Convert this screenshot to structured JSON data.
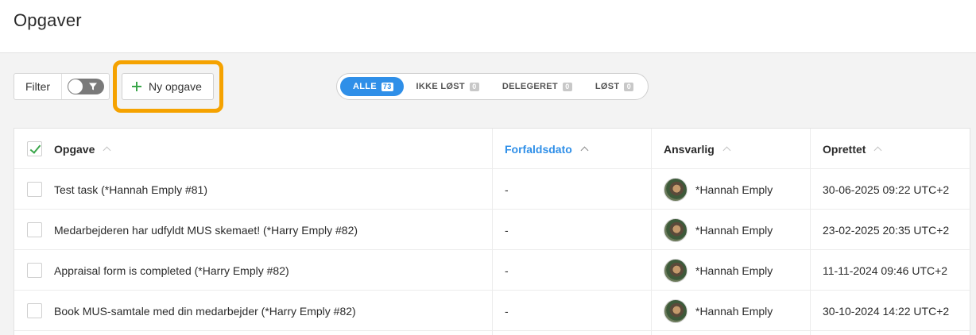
{
  "page": {
    "title": "Opgaver"
  },
  "toolbar": {
    "filter_label": "Filter",
    "new_task_label": "Ny opgave",
    "highlight_color": "#f5a200"
  },
  "status_tabs": [
    {
      "label": "ALLE",
      "count": "73",
      "active": true
    },
    {
      "label": "IKKE LØST",
      "count": "0",
      "active": false
    },
    {
      "label": "DELEGERET",
      "count": "0",
      "active": false
    },
    {
      "label": "LØST",
      "count": "0",
      "active": false
    }
  ],
  "table": {
    "headers": {
      "task": "Opgave",
      "due_date": "Forfaldsdato",
      "responsible": "Ansvarlig",
      "created": "Oprettet"
    },
    "rows": [
      {
        "task": "Test task (*Hannah Emply #81)",
        "due_date": "-",
        "responsible": "*Hannah Emply",
        "created": "30-06-2025 09:22 UTC+2"
      },
      {
        "task": "Medarbejderen har udfyldt MUS skemaet! (*Harry Emply #82)",
        "due_date": "-",
        "responsible": "*Hannah Emply",
        "created": "23-02-2025 20:35 UTC+2"
      },
      {
        "task": "Appraisal form is completed (*Harry Emply #82)",
        "due_date": "-",
        "responsible": "*Hannah Emply",
        "created": "11-11-2024 09:46 UTC+2"
      },
      {
        "task": "Book MUS-samtale med din medarbejder (*Harry Emply #82)",
        "due_date": "-",
        "responsible": "*Hannah Emply",
        "created": "30-10-2024 14:22 UTC+2"
      }
    ]
  },
  "colors": {
    "accent": "#2f8fe8",
    "check": "#3aa64a"
  }
}
